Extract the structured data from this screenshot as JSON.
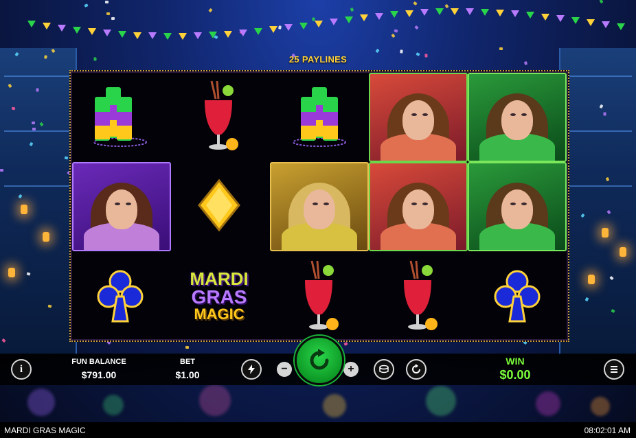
{
  "game": {
    "title": "MARDI GRAS MAGIC",
    "paylines_label": "25 PAYLINES",
    "logo": {
      "line1": "MARDI",
      "line2": "GRAS",
      "line3": "MAGIC"
    }
  },
  "reels": [
    [
      "shots",
      "queen-purple",
      "club"
    ],
    [
      "hurricane-drink",
      "diamond",
      "logo"
    ],
    [
      "shots",
      "queen-gold",
      "hurricane-drink"
    ],
    [
      "queen-red",
      "queen-red",
      "hurricane-drink"
    ],
    [
      "queen-green",
      "queen-green",
      "club"
    ]
  ],
  "controls": {
    "info_icon": "i",
    "fun_balance_label": "FUN BALANCE",
    "fun_balance_value": "$791.00",
    "bet_label": "BET",
    "bet_value": "$1.00",
    "minus": "−",
    "plus": "+",
    "win_label": "WIN",
    "win_value": "$0.00"
  },
  "footer": {
    "time": "08:02:01 AM"
  },
  "colors": {
    "paylines": "#ffd23a",
    "win": "#7cff3a",
    "spin": "#17b834"
  }
}
